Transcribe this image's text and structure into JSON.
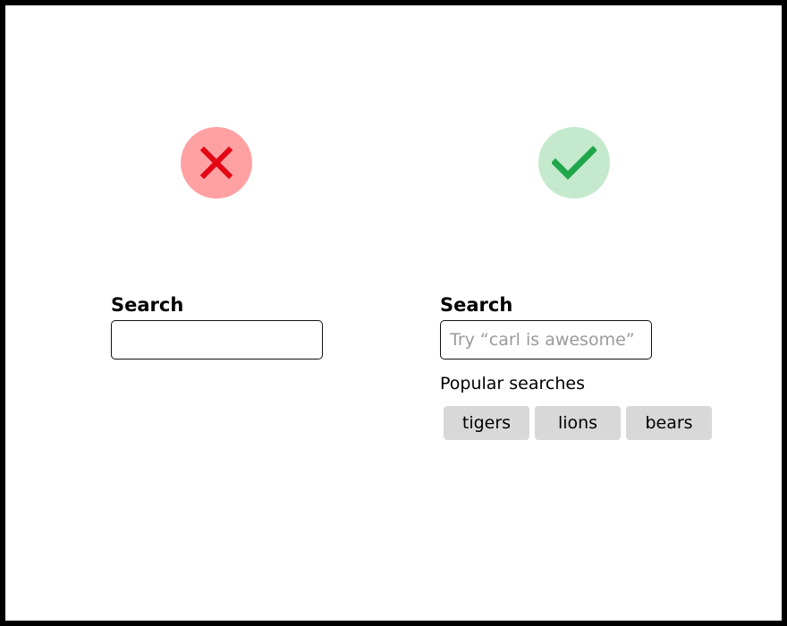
{
  "bad_example": {
    "icon": "x-mark-icon",
    "icon_color": "#e30613",
    "circle_color": "#ffa1a3",
    "label": "Search",
    "input_value": "",
    "input_placeholder": ""
  },
  "good_example": {
    "icon": "checkmark-icon",
    "icon_color": "#1fa64a",
    "circle_color": "#c4e9cc",
    "label": "Search",
    "input_value": "",
    "input_placeholder": "Try “carl is awesome”",
    "popular_label": "Popular searches",
    "popular_searches": [
      "tigers",
      "lions",
      "bears"
    ]
  }
}
